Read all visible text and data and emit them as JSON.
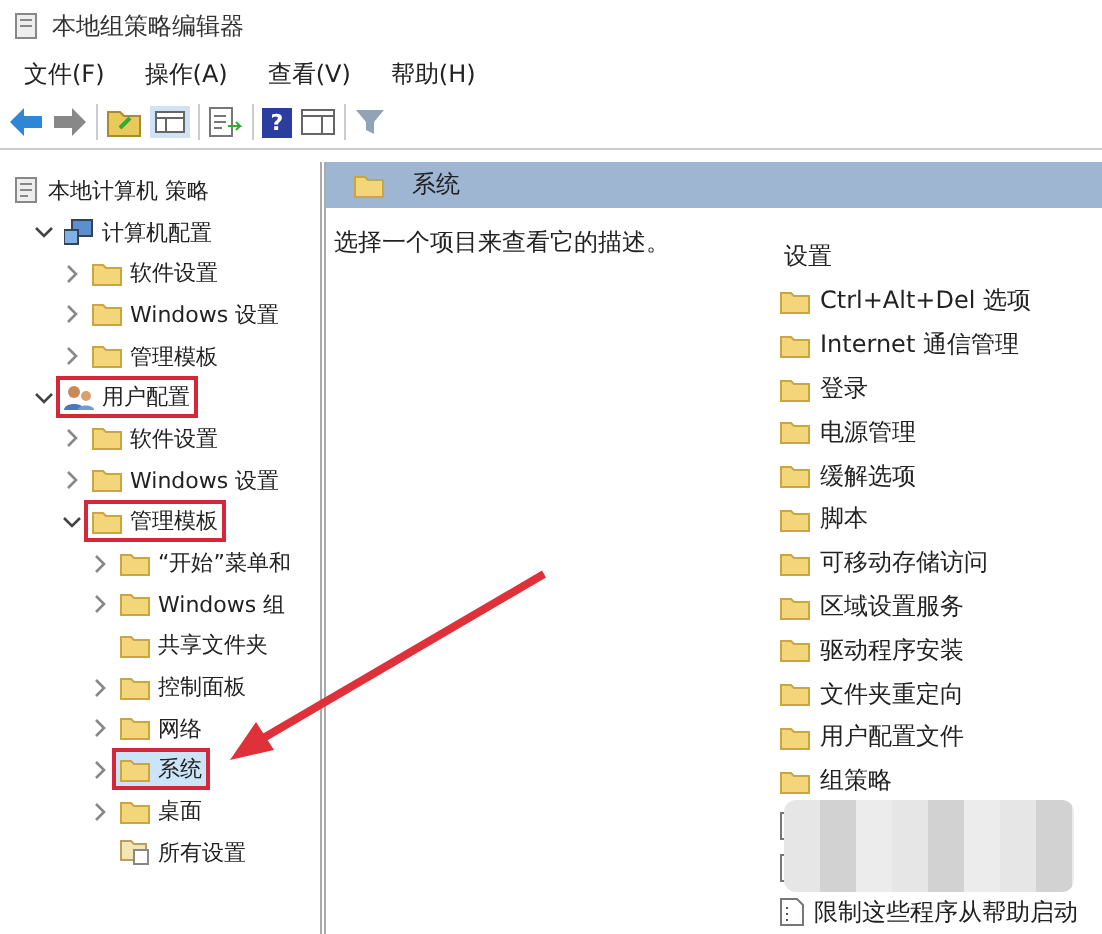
{
  "window": {
    "title": "本地组策略编辑器"
  },
  "menu": [
    {
      "label": "文件(F)"
    },
    {
      "label": "操作(A)"
    },
    {
      "label": "查看(V)"
    },
    {
      "label": "帮助(H)"
    }
  ],
  "toolbar": [
    {
      "kind": "back"
    },
    {
      "kind": "forward"
    },
    {
      "kind": "sep"
    },
    {
      "kind": "folder-up"
    },
    {
      "kind": "pane"
    },
    {
      "kind": "sep"
    },
    {
      "kind": "export"
    },
    {
      "kind": "sep"
    },
    {
      "kind": "help",
      "label": "?"
    },
    {
      "kind": "pane2"
    },
    {
      "kind": "sep"
    },
    {
      "kind": "filter"
    }
  ],
  "tree": [
    {
      "label": "本地计算机 策略",
      "kind": "policy",
      "children": [
        {
          "label": "计算机配置",
          "kind": "computer",
          "expanded": true,
          "annotated": false,
          "children": [
            {
              "label": "软件设置",
              "kind": "folder",
              "expanded": false,
              "has_children": true
            },
            {
              "label": "Windows 设置",
              "kind": "folder",
              "expanded": false,
              "has_children": true
            },
            {
              "label": "管理模板",
              "kind": "folder",
              "expanded": false,
              "has_children": true
            }
          ]
        },
        {
          "label": "用户配置",
          "kind": "user",
          "expanded": true,
          "annotated": true,
          "children": [
            {
              "label": "软件设置",
              "kind": "folder",
              "expanded": false,
              "has_children": true
            },
            {
              "label": "Windows 设置",
              "kind": "folder",
              "expanded": false,
              "has_children": true
            },
            {
              "label": "管理模板",
              "kind": "folder",
              "expanded": true,
              "annotated": true,
              "children": [
                {
                  "label": "“开始”菜单和",
                  "kind": "folder",
                  "expanded": false,
                  "has_children": true
                },
                {
                  "label": "Windows 组",
                  "kind": "folder",
                  "expanded": false,
                  "has_children": true
                },
                {
                  "label": "共享文件夹",
                  "kind": "folder",
                  "expanded": false,
                  "has_children": false
                },
                {
                  "label": "控制面板",
                  "kind": "folder",
                  "expanded": false,
                  "has_children": true
                },
                {
                  "label": "网络",
                  "kind": "folder",
                  "expanded": false,
                  "has_children": true
                },
                {
                  "label": "系统",
                  "kind": "folder",
                  "expanded": false,
                  "has_children": true,
                  "selected": true,
                  "annotated": true
                },
                {
                  "label": "桌面",
                  "kind": "folder",
                  "expanded": false,
                  "has_children": true
                },
                {
                  "label": "所有设置",
                  "kind": "settings",
                  "expanded": false,
                  "has_children": false
                }
              ]
            }
          ]
        }
      ]
    }
  ],
  "details": {
    "header": "系统",
    "description": "选择一个项目来查看它的描述。",
    "list_heading": "设置",
    "items": [
      {
        "label": "Ctrl+Alt+Del 选项",
        "kind": "folder"
      },
      {
        "label": "Internet 通信管理",
        "kind": "folder"
      },
      {
        "label": "登录",
        "kind": "folder"
      },
      {
        "label": "电源管理",
        "kind": "folder"
      },
      {
        "label": "缓解选项",
        "kind": "folder"
      },
      {
        "label": "脚本",
        "kind": "folder"
      },
      {
        "label": "可移动存储访问",
        "kind": "folder"
      },
      {
        "label": "区域设置服务",
        "kind": "folder"
      },
      {
        "label": "驱动程序安装",
        "kind": "folder"
      },
      {
        "label": "文件夹重定向",
        "kind": "folder"
      },
      {
        "label": "用户配置文件",
        "kind": "folder"
      },
      {
        "label": "组策略",
        "kind": "folder"
      },
      {
        "kind": "hidden-setting"
      },
      {
        "kind": "hidden-setting"
      },
      {
        "label": "限制这些程序从帮助启动",
        "kind": "setting"
      }
    ]
  }
}
